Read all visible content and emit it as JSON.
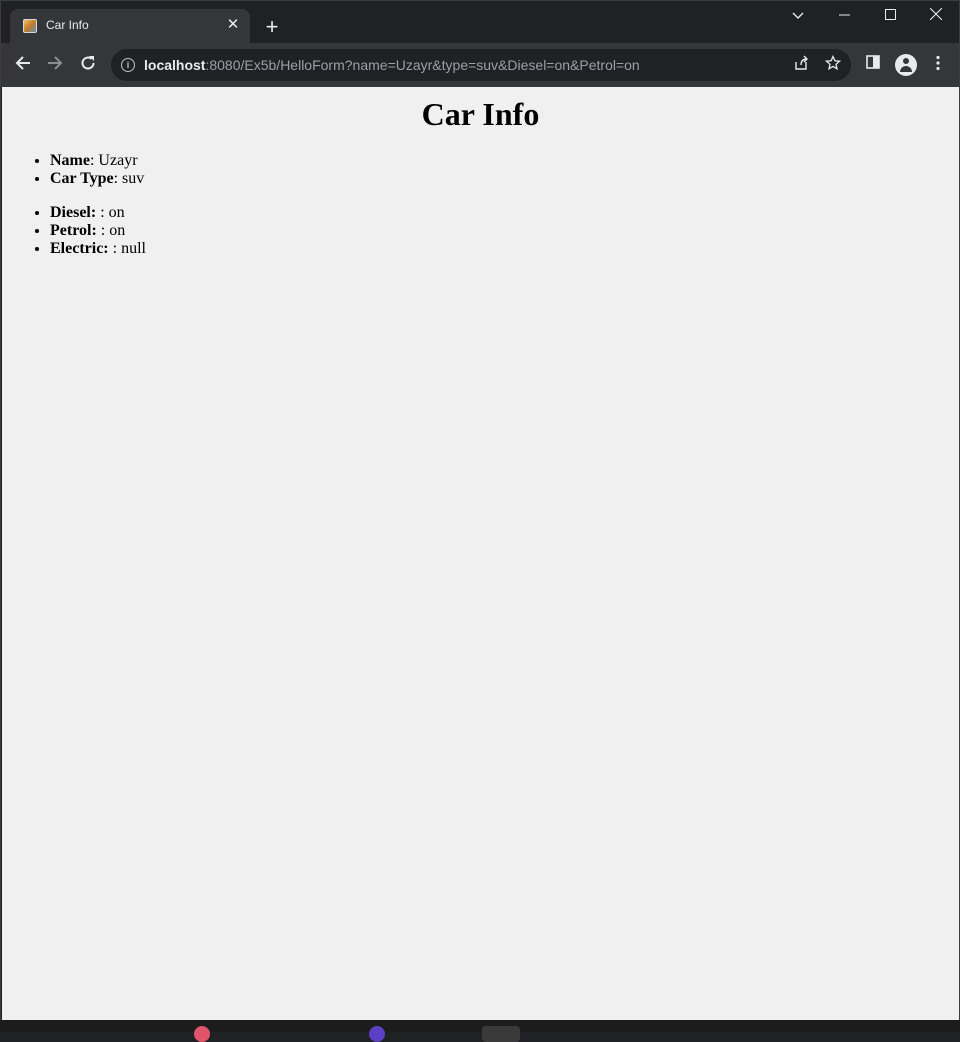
{
  "browser": {
    "tab_title": "Car Info",
    "tab_close_glyph": "✕",
    "new_tab_glyph": "+",
    "url_host": "localhost",
    "url_rest": ":8080/Ex5b/HelloForm?name=Uzayr&type=suv&Diesel=on&Petrol=on"
  },
  "page": {
    "title": "Car Info",
    "details": [
      {
        "label": "Name",
        "value": ": Uzayr"
      },
      {
        "label": "Car Type",
        "value": ": suv"
      }
    ],
    "fuels": [
      {
        "label": "Diesel:",
        "value": " : on"
      },
      {
        "label": "Petrol:",
        "value": " : on"
      },
      {
        "label": "Electric:",
        "value": " : null"
      }
    ]
  },
  "colors": {
    "chrome_dark": "#202124",
    "toolbar": "#35363a",
    "page_bg": "#f0f0f0"
  }
}
